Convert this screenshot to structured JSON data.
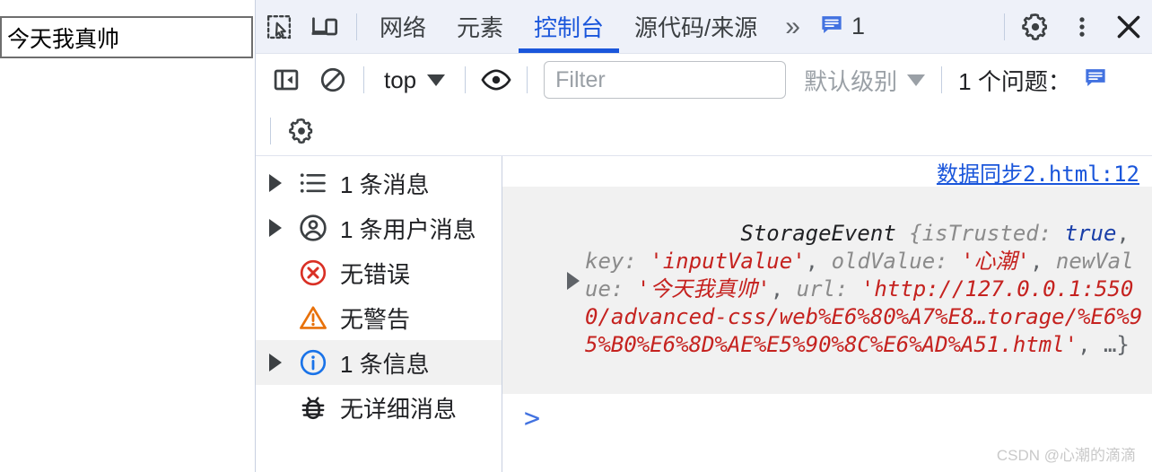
{
  "page": {
    "input_value": "今天我真帅",
    "input_placeholder": ""
  },
  "devtools": {
    "tabbar": {
      "inspect_icon": "inspect-element-icon",
      "device_icon": "device-toolbar-icon",
      "tabs": [
        {
          "label": "网络",
          "active": false
        },
        {
          "label": "元素",
          "active": false
        },
        {
          "label": "控制台",
          "active": true
        },
        {
          "label": "源代码/来源",
          "active": false
        }
      ],
      "more_label": "»",
      "message_badge_icon": "message-icon",
      "message_badge_count": "1",
      "settings_icon": "gear-icon",
      "kebab_icon": "more-vertical-icon",
      "close_icon": "close-icon"
    },
    "filterbar": {
      "sidebar_toggle_icon": "show-console-sidebar-icon",
      "clear_icon": "clear-console-icon",
      "context_value": "top",
      "eye_icon": "live-expression-icon",
      "filter_placeholder": "Filter",
      "filter_value": "",
      "level_value": "默认级别",
      "issues_label": "1 个问题：",
      "issues_icon": "message-icon"
    },
    "settingsbar": {
      "settings_icon": "gear-icon"
    },
    "sidebar": {
      "items": [
        {
          "label": "1 条消息",
          "icon": "list-icon",
          "expandable": true,
          "selected": false
        },
        {
          "label": "1 条用户消息",
          "icon": "person-icon",
          "expandable": true,
          "selected": false
        },
        {
          "label": "无错误",
          "icon": "error-icon",
          "expandable": false,
          "selected": false
        },
        {
          "label": "无警告",
          "icon": "warning-icon",
          "expandable": false,
          "selected": false
        },
        {
          "label": "1 条信息",
          "icon": "info-icon",
          "expandable": true,
          "selected": true
        },
        {
          "label": "无详细消息",
          "icon": "bug-icon",
          "expandable": false,
          "selected": false
        }
      ]
    },
    "console": {
      "source_link": "数据同步2.html:12",
      "message": {
        "constructor": "StorageEvent",
        "open_brace": " {",
        "fields": [
          {
            "key": "isTrusted",
            "sep": ": ",
            "value": "true",
            "kind": "bool"
          },
          {
            "key": "key",
            "sep": ": ",
            "value": "'inputValue'",
            "kind": "str"
          },
          {
            "key": "oldValue",
            "sep": ": ",
            "value": "'心潮'",
            "kind": "str"
          },
          {
            "key": "newValue",
            "sep": ": ",
            "value": "'今天我真帅'",
            "kind": "str"
          },
          {
            "key": "url",
            "sep": ": ",
            "value": "'http://127.0.0.1:5500/advanced-css/web%E6%80%A7%E8…torage/%E6%95%B0%E6%8D%AE%E5%90%8C%E6%AD%A51.html'",
            "kind": "str"
          }
        ],
        "ellipsis_tail": ", …}",
        "separator": ", "
      },
      "prompt_symbol": ">"
    }
  },
  "watermark": "CSDN @心潮的滴滴",
  "colors": {
    "accent": "#1a56db",
    "error": "#c5221f",
    "warning": "#e8710a",
    "toolbar_bg": "#eef1f9",
    "message_bg": "#f1f1f1"
  }
}
